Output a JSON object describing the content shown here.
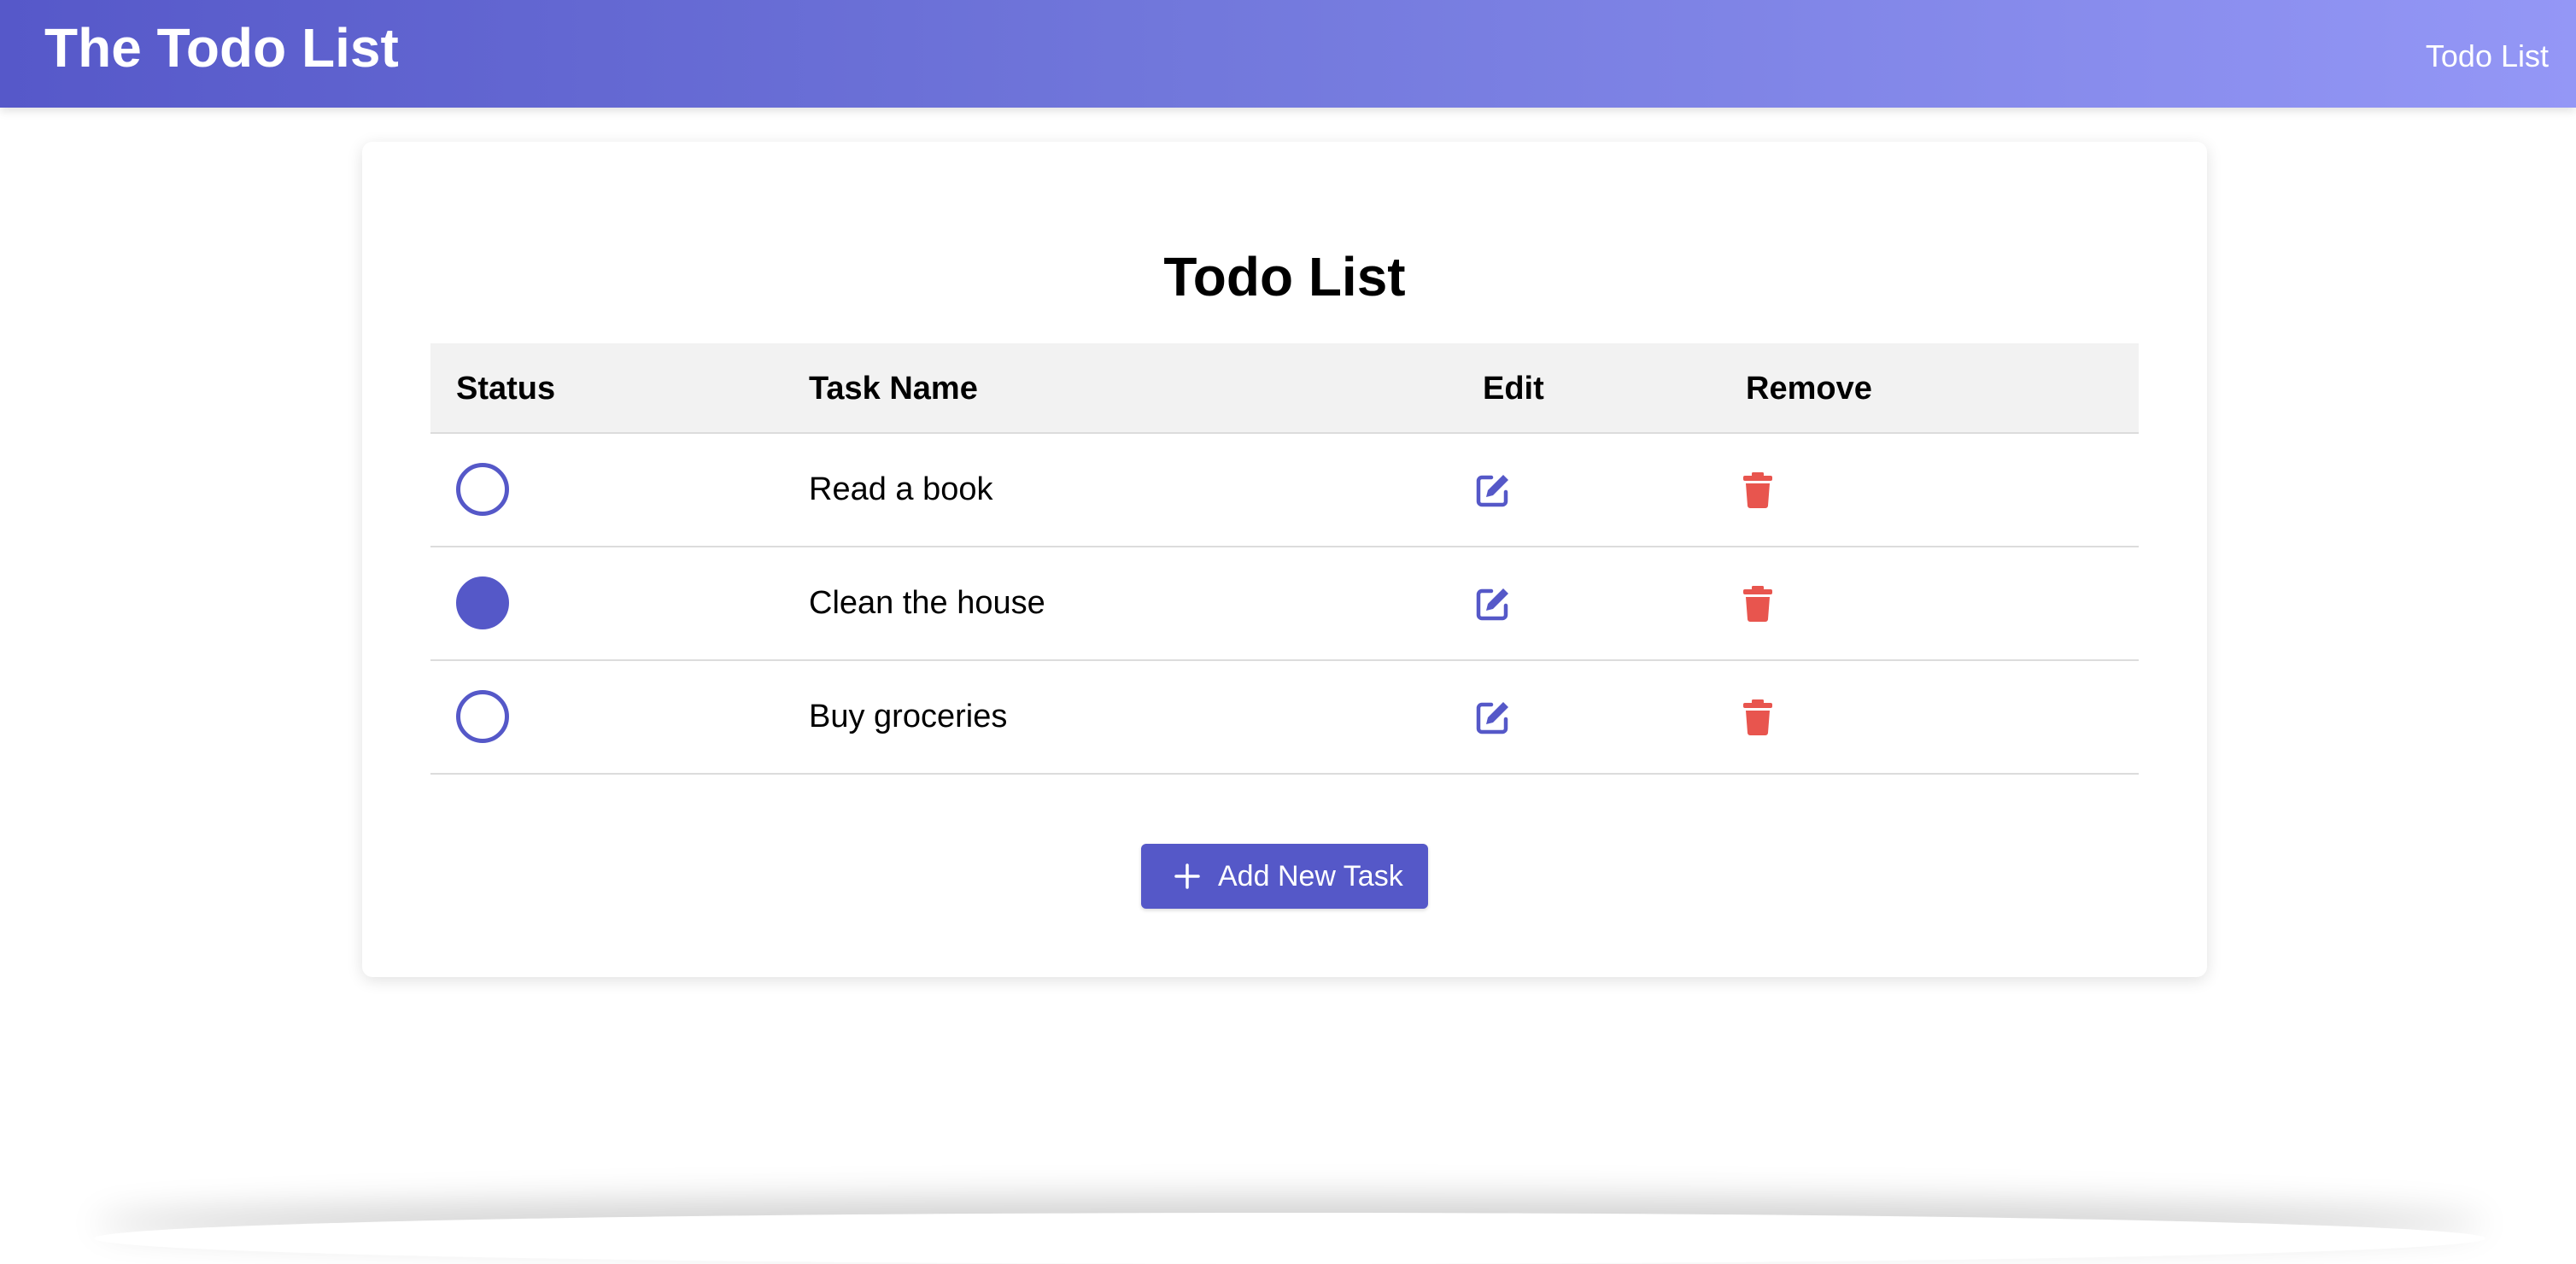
{
  "header": {
    "brand": "The Todo List",
    "nav_link": "Todo List"
  },
  "main": {
    "title": "Todo List",
    "columns": {
      "status": "Status",
      "task_name": "Task Name",
      "edit": "Edit",
      "remove": "Remove"
    },
    "tasks": [
      {
        "name": "Read a book",
        "completed": false
      },
      {
        "name": "Clean the house",
        "completed": true
      },
      {
        "name": "Buy groceries",
        "completed": false
      }
    ],
    "add_button_label": "Add New Task"
  },
  "icons": {
    "edit": "pen-to-square-icon",
    "remove": "trash-icon",
    "add": "plus-icon"
  },
  "colors": {
    "accent": "#5558c8",
    "header_gradient_start": "#5658c9",
    "header_gradient_end": "#9497f6",
    "danger": "#e8554e",
    "table_header_bg": "#f2f2f2"
  }
}
